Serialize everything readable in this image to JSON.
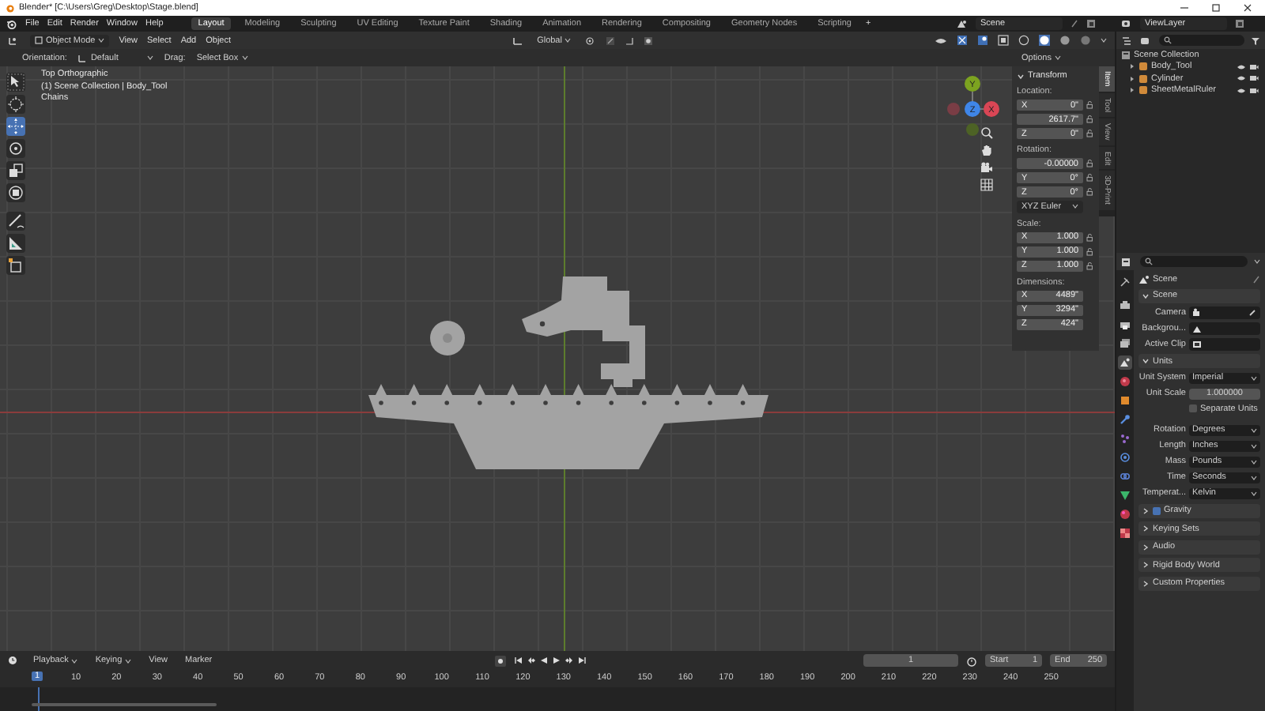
{
  "window": {
    "title": "Blender* [C:\\Users\\Greg\\Desktop\\Stage.blend]"
  },
  "menu": [
    "File",
    "Edit",
    "Render",
    "Window",
    "Help"
  ],
  "workspaces": [
    {
      "label": "Layout",
      "selected": true
    },
    {
      "label": "Modeling",
      "selected": false
    },
    {
      "label": "Sculpting",
      "selected": false
    },
    {
      "label": "UV Editing",
      "selected": false
    },
    {
      "label": "Texture Paint",
      "selected": false
    },
    {
      "label": "Shading",
      "selected": false
    },
    {
      "label": "Animation",
      "selected": false
    },
    {
      "label": "Rendering",
      "selected": false
    },
    {
      "label": "Compositing",
      "selected": false
    },
    {
      "label": "Geometry Nodes",
      "selected": false
    },
    {
      "label": "Scripting",
      "selected": false
    }
  ],
  "add_workspace": "+",
  "scene": "Scene",
  "view_layer": "ViewLayer",
  "viewport_header": {
    "mode": "Object Mode",
    "menus": [
      "View",
      "Select",
      "Add",
      "Object"
    ],
    "orientation": "Global"
  },
  "tool_header": {
    "orientation_label": "Orientation:",
    "orientation": "Default",
    "drag_label": "Drag:",
    "drag": "Select Box",
    "options": "Options"
  },
  "toolbar": [
    {
      "kind": "select_box",
      "selected": false
    },
    {
      "kind": "cursor",
      "selected": false
    },
    {
      "kind": "move",
      "selected": true
    },
    {
      "kind": "rotate",
      "selected": false
    },
    {
      "kind": "scale",
      "selected": false
    },
    {
      "kind": "transform",
      "selected": false
    },
    {
      "kind": "annotate",
      "selected": false
    },
    {
      "kind": "measure",
      "selected": false
    },
    {
      "kind": "add_cube",
      "selected": false
    }
  ],
  "overlay_text": [
    "Top Orthographic",
    "(1) Scene Collection | Body_Tool",
    "Chains"
  ],
  "gizmo": {
    "x": "X",
    "y": "Y",
    "z": "Z"
  },
  "sidebar": {
    "tabs": [
      {
        "label": "Item",
        "selected": true
      },
      {
        "label": "Tool",
        "selected": false
      },
      {
        "label": "View",
        "selected": false
      },
      {
        "label": "Edit",
        "selected": false
      },
      {
        "label": "3D-Print",
        "selected": false
      }
    ],
    "title": "Transform",
    "expanded": true,
    "groups": [
      {
        "label": "Location:",
        "locks": true,
        "fields": [
          {
            "axis": "X",
            "value": "0\""
          },
          {
            "value": "2617.7\""
          },
          {
            "axis": "Z",
            "value": "0\""
          }
        ]
      },
      {
        "label": "Rotation:",
        "locks": true,
        "fields": [
          {
            "value": "-0.00000"
          },
          {
            "axis": "Y",
            "value": "0°"
          },
          {
            "axis": "Z",
            "value": "0°"
          }
        ],
        "mode": "XYZ Euler"
      },
      {
        "label": "Scale:",
        "locks": true,
        "fields": [
          {
            "axis": "X",
            "value": "1.000"
          },
          {
            "axis": "Y",
            "value": "1.000"
          },
          {
            "axis": "Z",
            "value": "1.000"
          }
        ]
      },
      {
        "label": "Dimensions:",
        "locks": false,
        "fields": [
          {
            "axis": "X",
            "value": "4489\""
          },
          {
            "axis": "Y",
            "value": "3294\""
          },
          {
            "axis": "Z",
            "value": "424\""
          }
        ]
      }
    ]
  },
  "outliner": {
    "root": "Scene Collection",
    "items": [
      {
        "name": "Body_Tool"
      },
      {
        "name": "Cylinder"
      },
      {
        "name": "SheetMetalRuler"
      }
    ]
  },
  "properties": {
    "tabs": [
      {
        "kind": "tool",
        "selected": false
      },
      {
        "kind": "render",
        "selected": false
      },
      {
        "kind": "output",
        "selected": false
      },
      {
        "kind": "view_layer",
        "selected": false
      },
      {
        "kind": "scene",
        "selected": true
      },
      {
        "kind": "world",
        "selected": false
      },
      {
        "kind": "object",
        "selected": false
      },
      {
        "kind": "modifier",
        "selected": false
      },
      {
        "kind": "particles",
        "selected": false
      },
      {
        "kind": "physics",
        "selected": false
      },
      {
        "kind": "constraints",
        "selected": false
      },
      {
        "kind": "data",
        "selected": false
      },
      {
        "kind": "material",
        "selected": false
      },
      {
        "kind": "texture",
        "selected": false
      }
    ],
    "context": "Scene",
    "scene_panel": {
      "title": "Scene",
      "expanded": true,
      "rows": [
        {
          "label": "Camera",
          "kind": "camera"
        },
        {
          "label": "Backgrou...",
          "kind": "scene"
        },
        {
          "label": "Active Clip",
          "kind": "clip"
        }
      ]
    },
    "units_panel": {
      "title": "Units",
      "expanded": true,
      "unit_system_label": "Unit System",
      "unit_system": "Imperial",
      "unit_scale_label": "Unit Scale",
      "unit_scale": "1.000000",
      "separate_units": {
        "label": "Separate Units",
        "checked": false
      },
      "rows": [
        {
          "label": "Rotation",
          "value": "Degrees"
        },
        {
          "label": "Length",
          "value": "Inches"
        },
        {
          "label": "Mass",
          "value": "Pounds"
        },
        {
          "label": "Time",
          "value": "Seconds"
        },
        {
          "label": "Temperat...",
          "value": "Kelvin"
        }
      ]
    },
    "gravity": {
      "label": "Gravity",
      "checked": true,
      "expanded": false
    },
    "collapsed_panels": [
      {
        "label": "Keying Sets",
        "expanded": false
      },
      {
        "label": "Audio",
        "expanded": false
      },
      {
        "label": "Rigid Body World",
        "expanded": false
      },
      {
        "label": "Custom Properties",
        "expanded": false
      }
    ]
  },
  "timeline": {
    "menus": [
      "Playback",
      "Keying",
      "View",
      "Marker"
    ],
    "current_frame": "1",
    "start_label": "Start",
    "start": "1",
    "end_label": "End",
    "end": "250",
    "playhead": "1",
    "ticks": [
      "10",
      "20",
      "30",
      "40",
      "50",
      "60",
      "70",
      "80",
      "90",
      "100",
      "110",
      "120",
      "130",
      "140",
      "150",
      "160",
      "170",
      "180",
      "190",
      "200",
      "210",
      "220",
      "230",
      "240",
      "250"
    ]
  }
}
